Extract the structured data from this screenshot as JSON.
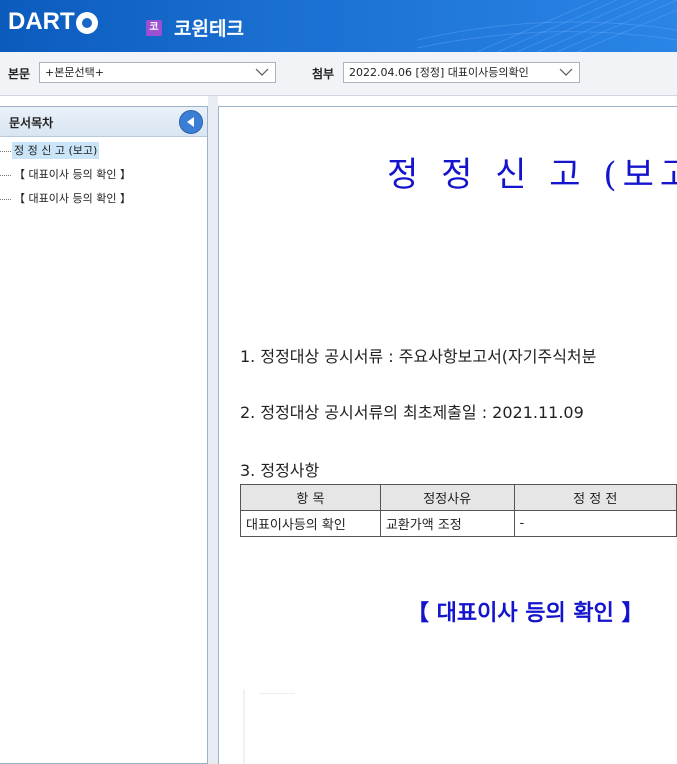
{
  "header": {
    "logo_text": "DART",
    "company_badge": "코",
    "company_name": "코윈테크",
    "colors": {
      "bar": "#1a6fd1",
      "badge": "#9b4fd3"
    }
  },
  "toolbar": {
    "main_label": "본문",
    "main_select_value": "+본문선택+",
    "attach_label": "첨부",
    "attach_select_value": "2022.04.06  [정정] 대표이사등의확인"
  },
  "sidebar": {
    "title": "문서목차",
    "collapse_icon": "chevron-left-icon",
    "items": [
      {
        "label": "정 정 신 고 (보고)",
        "selected": true
      },
      {
        "label": "【 대표이사 등의 확인 】",
        "selected": false
      },
      {
        "label": "【 대표이사 등의 확인 】",
        "selected": false
      }
    ]
  },
  "document": {
    "title": "정 정 신 고 (보고",
    "item1": "1. 정정대상 공시서류 : 주요사항보고서(자기주식처분",
    "item2": "2. 정정대상 공시서류의 최초제출일 : 2021.11.09",
    "item3": "3. 정정사항",
    "table": {
      "headers": [
        "항  목",
        "정정사유",
        "정 정 전"
      ],
      "rows": [
        [
          "대표이사등의 확인",
          "교환가액 조정",
          "-"
        ]
      ]
    },
    "section_title": "【 대표이사 등의 확인 】",
    "colors": {
      "title": "#1414cc"
    }
  }
}
